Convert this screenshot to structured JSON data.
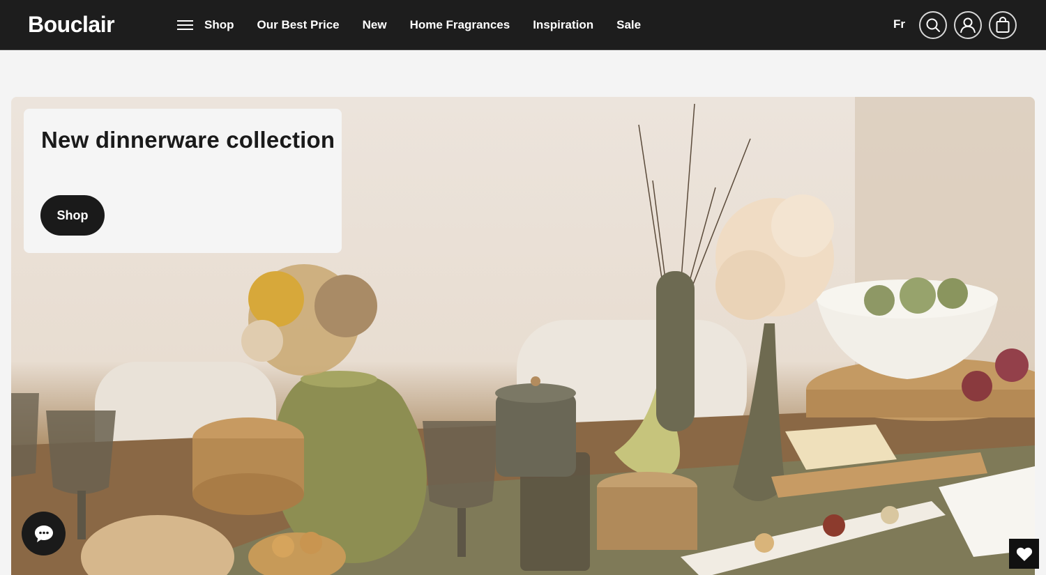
{
  "header": {
    "logo": "Bouclair",
    "nav": [
      {
        "label": "Shop"
      },
      {
        "label": "Our Best Price"
      },
      {
        "label": "New"
      },
      {
        "label": "Home Fragrances"
      },
      {
        "label": "Inspiration"
      },
      {
        "label": "Sale"
      }
    ],
    "language": "Fr",
    "icons": [
      "search-icon",
      "account-icon",
      "cart-icon"
    ]
  },
  "hero": {
    "title": "New dinnerware collection",
    "cta_label": "Shop",
    "image": "dining table with dried flowers, vases, glasses and food"
  },
  "floating": {
    "chat_icon": "chat-bubble-icon",
    "wishlist_icon": "heart-icon"
  },
  "colors": {
    "header_bg": "#1d1d1d",
    "accent": "#1a1a1a",
    "page_bg": "#f4f4f4"
  }
}
